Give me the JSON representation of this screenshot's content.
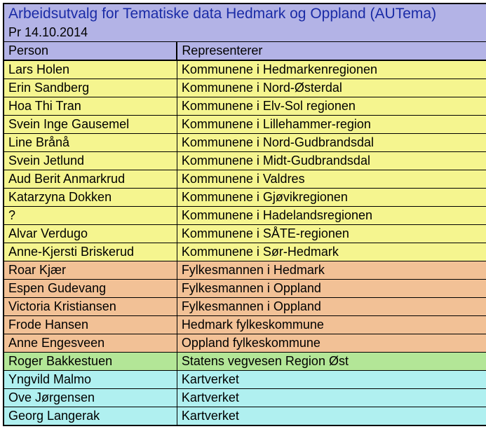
{
  "title": "Arbeidsutvalg for Tematiske data Hedmark og Oppland (AUTema)",
  "date": "Pr 14.10.2014",
  "headers": {
    "person": "Person",
    "represents": "Representerer"
  },
  "rows": [
    {
      "person": "Lars Holen",
      "represents": "Kommunene i Hedmarkenregionen",
      "color": "yellow"
    },
    {
      "person": "Erin Sandberg",
      "represents": "Kommunene i Nord-Østerdal",
      "color": "yellow"
    },
    {
      "person": "Hoa Thi Tran",
      "represents": "Kommunene i Elv-Sol regionen",
      "color": "yellow"
    },
    {
      "person": "Svein Inge Gausemel",
      "represents": "Kommunene i Lillehammer-region",
      "color": "yellow"
    },
    {
      "person": "Line Brånå",
      "represents": "Kommunene i Nord-Gudbrandsdal",
      "color": "yellow"
    },
    {
      "person": "Svein Jetlund",
      "represents": "Kommunene i Midt-Gudbrandsdal",
      "color": "yellow"
    },
    {
      "person": "Aud Berit Anmarkrud",
      "represents": "Kommunene i Valdres",
      "color": "yellow"
    },
    {
      "person": "Katarzyna Dokken",
      "represents": "Kommunene i Gjøvikregionen",
      "color": "yellow"
    },
    {
      "person": "?",
      "represents": "Kommunene i Hadelandsregionen",
      "color": "yellow"
    },
    {
      "person": "Alvar Verdugo",
      "represents": "Kommunene i SÅTE-regionen",
      "color": "yellow"
    },
    {
      "person": "Anne-Kjersti Briskerud",
      "represents": "Kommunene i Sør-Hedmark",
      "color": "yellow"
    },
    {
      "person": "Roar Kjær",
      "represents": "Fylkesmannen i Hedmark",
      "color": "orange"
    },
    {
      "person": "Espen Gudevang",
      "represents": "Fylkesmannen i Oppland",
      "color": "orange"
    },
    {
      "person": "Victoria Kristiansen",
      "represents": "Fylkesmannen i Oppland",
      "color": "orange"
    },
    {
      "person": "Frode Hansen",
      "represents": "Hedmark fylkeskommune",
      "color": "orange"
    },
    {
      "person": "Anne Engesveen",
      "represents": "Oppland fylkeskommune",
      "color": "orange"
    },
    {
      "person": "Roger Bakkestuen",
      "represents": "Statens vegvesen Region Øst",
      "color": "green"
    },
    {
      "person": "Yngvild Malmo",
      "represents": "Kartverket",
      "color": "cyan"
    },
    {
      "person": "Ove Jørgensen",
      "represents": "Kartverket",
      "color": "cyan"
    },
    {
      "person": "Georg Langerak",
      "represents": "Kartverket",
      "color": "cyan"
    }
  ]
}
